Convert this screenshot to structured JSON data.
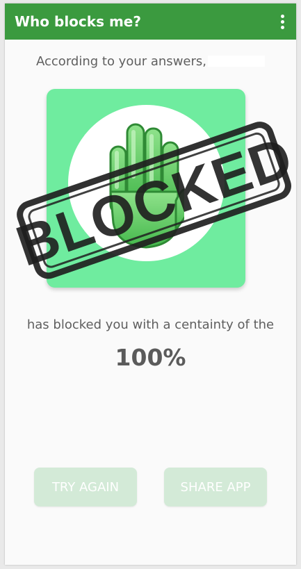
{
  "app_bar": {
    "title": "Who blocks me?",
    "menu_icon": "more-vert-icon",
    "color": "#3b9a3f"
  },
  "result": {
    "intro": "According to your answers,",
    "image_card_color": "#6fec9f",
    "hand_icon": "stop-hand-icon",
    "stamp_text": "BLOCKED",
    "statement": "has blocked you with a centainty of the",
    "certainty": "100%"
  },
  "actions": {
    "try_again_label": "TRY AGAIN",
    "share_label": "SHARE APP",
    "button_color": "#d3ead7"
  }
}
